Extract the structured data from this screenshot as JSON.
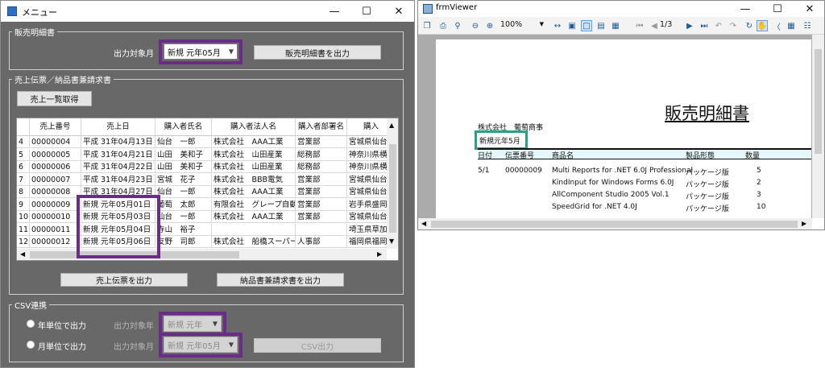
{
  "menu": {
    "title": "メニュー",
    "sales_group": {
      "label": "販売明細書",
      "target_label": "出力対象月",
      "target_value": "新規 元年05月",
      "output_button": "販売明細書を出力"
    },
    "slip_group": {
      "label": "売上伝票／納品書兼請求書",
      "fetch_button": "売上一覧取得",
      "columns": [
        "売上番号",
        "売上日",
        "購入者氏名",
        "購入者法人名",
        "購入者部署名",
        "購入"
      ],
      "rows": [
        {
          "idx": "4",
          "cells": [
            "00000004",
            "平成 31年04月13日",
            "仙台　一郎",
            "株式会社　AAA工業",
            "営業部",
            "宮城県仙台"
          ]
        },
        {
          "idx": "5",
          "cells": [
            "00000005",
            "平成 31年04月21日",
            "山田　美和子",
            "株式会社　山田産業",
            "総務部",
            "神奈川県横"
          ]
        },
        {
          "idx": "6",
          "cells": [
            "00000006",
            "平成 31年04月22日",
            "山田　美和子",
            "株式会社　山田産業",
            "総務部",
            "神奈川県横"
          ]
        },
        {
          "idx": "7",
          "cells": [
            "00000007",
            "平成 31年04月23日",
            "宮城　花子",
            "株式会社　BBB電気",
            "営業部",
            "宮城県仙台"
          ]
        },
        {
          "idx": "8",
          "cells": [
            "00000008",
            "平成 31年04月27日",
            "仙台　一郎",
            "株式会社　AAA工業",
            "営業部",
            "宮城県仙台"
          ]
        },
        {
          "idx": "9",
          "cells": [
            "00000009",
            "新規 元年05月01日",
            "葡萄　太郎",
            "有限会社　グレープ自動車",
            "営業部",
            "岩手県盛岡"
          ]
        },
        {
          "idx": "10",
          "cells": [
            "00000010",
            "新規 元年05月03日",
            "仙台　一郎",
            "株式会社　AAA工業",
            "営業部",
            "宮城県仙台"
          ]
        },
        {
          "idx": "11",
          "cells": [
            "00000011",
            "新規 元年05月04日",
            "寺山　裕子",
            "",
            "",
            "埼玉県草加"
          ]
        },
        {
          "idx": "12",
          "cells": [
            "00000012",
            "新規 元年05月06日",
            "友野　司郎",
            "株式会社　船橋スーパー",
            "人事部",
            "福岡県福岡"
          ]
        }
      ],
      "slip_button": "売上伝票を出力",
      "invoice_button": "納品書兼請求書を出力"
    },
    "csv_group": {
      "label": "CSV連携",
      "year_radio": "年単位で出力",
      "year_target_label": "出力対象年",
      "year_value": "新規 元年",
      "month_radio": "月単位で出力",
      "month_target_label": "出力対象月",
      "month_value": "新規 元年05月",
      "csv_button": "CSV出力"
    }
  },
  "viewer": {
    "title": "frmViewer",
    "zoom": "100%",
    "page": "1/3",
    "report": {
      "title": "販売明細書",
      "company": "株式会社　葡萄商事",
      "period": "新規元年5月",
      "headers": [
        "日付",
        "伝票番号",
        "商品名",
        "製品形態",
        "数量"
      ],
      "rows": [
        [
          "5/1",
          "00000009",
          "Multi Reports for .NET 6.0J Professional",
          "パッケージ版",
          "5"
        ],
        [
          "",
          "",
          "KindInput for Windows Forms 6.0J",
          "パッケージ版",
          "2"
        ],
        [
          "",
          "",
          "AllComponent Studio 2005 Vol.1",
          "パッケージ版",
          "3"
        ],
        [
          "",
          "",
          "SpeedGrid for .NET 4.0J",
          "パッケージ版",
          "10"
        ]
      ]
    }
  },
  "colors": {
    "menu_bg": "#686868",
    "highlight_purple": "#6a2c88",
    "highlight_green": "#2aa184",
    "viewer_bg": "#ababab"
  }
}
